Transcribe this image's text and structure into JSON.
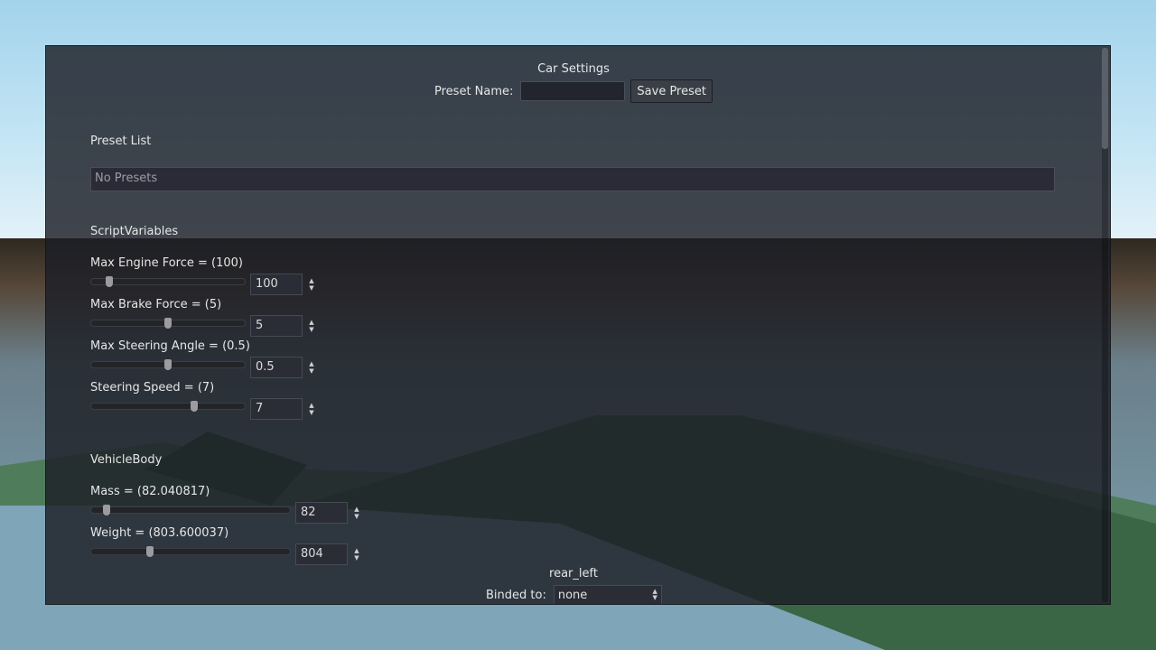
{
  "panel": {
    "title": "Car Settings",
    "preset_name_label": "Preset Name:",
    "preset_name_value": "",
    "save_button": "Save Preset"
  },
  "preset_list": {
    "heading": "Preset List",
    "empty_text": "No Presets"
  },
  "script_variables": {
    "heading": "ScriptVariables",
    "items": [
      {
        "label": "Max Engine Force = (100)",
        "value": "100",
        "fraction": 0.1
      },
      {
        "label": "Max Brake Force = (5)",
        "value": "5",
        "fraction": 0.5
      },
      {
        "label": "Max Steering Angle = (0.5)",
        "value": "0.5",
        "fraction": 0.5
      },
      {
        "label": "Steering Speed = (7)",
        "value": "7",
        "fraction": 0.68
      }
    ]
  },
  "vehicle_body": {
    "heading": "VehicleBody",
    "items": [
      {
        "label": "Mass = (82.040817)",
        "value": "82",
        "fraction": 0.06
      },
      {
        "label": "Weight = (803.600037)",
        "value": "804",
        "fraction": 0.29
      }
    ]
  },
  "wheel_binding": {
    "wheel_name": "rear_left",
    "binded_label": "Binded to:",
    "selected": "none"
  },
  "colors": {
    "panel_bg": "#1c1f26",
    "field_bg": "#2b2d36",
    "text": "#e6e6e6"
  }
}
